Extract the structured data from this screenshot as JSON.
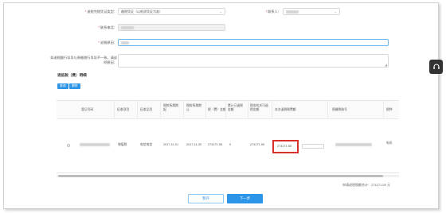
{
  "form": {
    "refund_type": {
      "label": "退税完税凭证类型：",
      "value": "缴税凭证（以纸质凭证为准）"
    },
    "contact": {
      "label": "联系人：",
      "value": ""
    },
    "contact_phone_label": "联系电话：",
    "refund_reason_label": "退税原因：",
    "refund_reason_placeholder": "",
    "batch_label": "如退税额行导导与原缴税行导导不一致，请说明原因："
  },
  "section_title": "退抵税（费）明细",
  "buttons": {
    "query": "查询",
    "delete": "删除",
    "save": "暂存",
    "next": "下一步"
  },
  "table": {
    "headers": [
      "登记号码",
      "征收项目",
      "征收品目",
      "税款所属期起",
      "税款所属期止",
      "税（费）金额",
      "累计已退税金额",
      "税务机关可退税金额",
      "本次退税税费额",
      "原缴税账号",
      "税种"
    ],
    "row": {
      "item": "增值税",
      "subitem": "电信电信",
      "period_start": "2017-11-01",
      "period_end": "2017-11-30",
      "amount": "274271.55",
      "refunded": "0",
      "refundable": "274271.55",
      "current_refund": "274271.55",
      "tax_type_note": "电讯"
    }
  },
  "summary": "申请退税税额合计：274271.55 元"
}
